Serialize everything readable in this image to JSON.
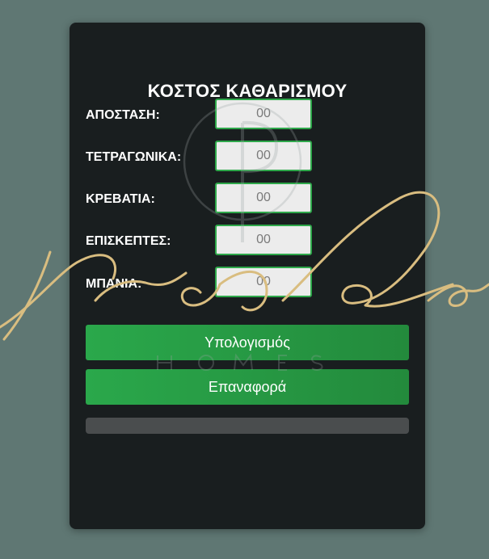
{
  "calculator": {
    "title": "ΚΟΣΤΟΣ ΚΑΘΑΡΙΣΜΟΥ",
    "fields": [
      {
        "label": "ΑΠΟΣΤΑΣΗ:",
        "placeholder": "00",
        "value": ""
      },
      {
        "label": "ΤΕΤΡΑΓΩΝΙΚΑ:",
        "placeholder": "00",
        "value": ""
      },
      {
        "label": "ΚΡΕΒΑΤΙΑ:",
        "placeholder": "00",
        "value": ""
      },
      {
        "label": "ΕΠΙΣΚΕΠΤΕΣ:",
        "placeholder": "00",
        "value": ""
      },
      {
        "label": "ΜΠΑΝΙΑ:",
        "placeholder": "00",
        "value": ""
      }
    ],
    "calculate_label": "Υπολογισμός",
    "reset_label": "Επαναφορά",
    "result_text": ""
  },
  "colors": {
    "page_background": "#5f7773",
    "card_background": "#191e1f",
    "accent_green": "#2aa84b",
    "input_background": "#ececec",
    "result_bar": "#4a4d4e",
    "logo_script": "#d9bd80"
  },
  "logo": {
    "script_text": "Perla",
    "sub_text": "HOMES"
  }
}
